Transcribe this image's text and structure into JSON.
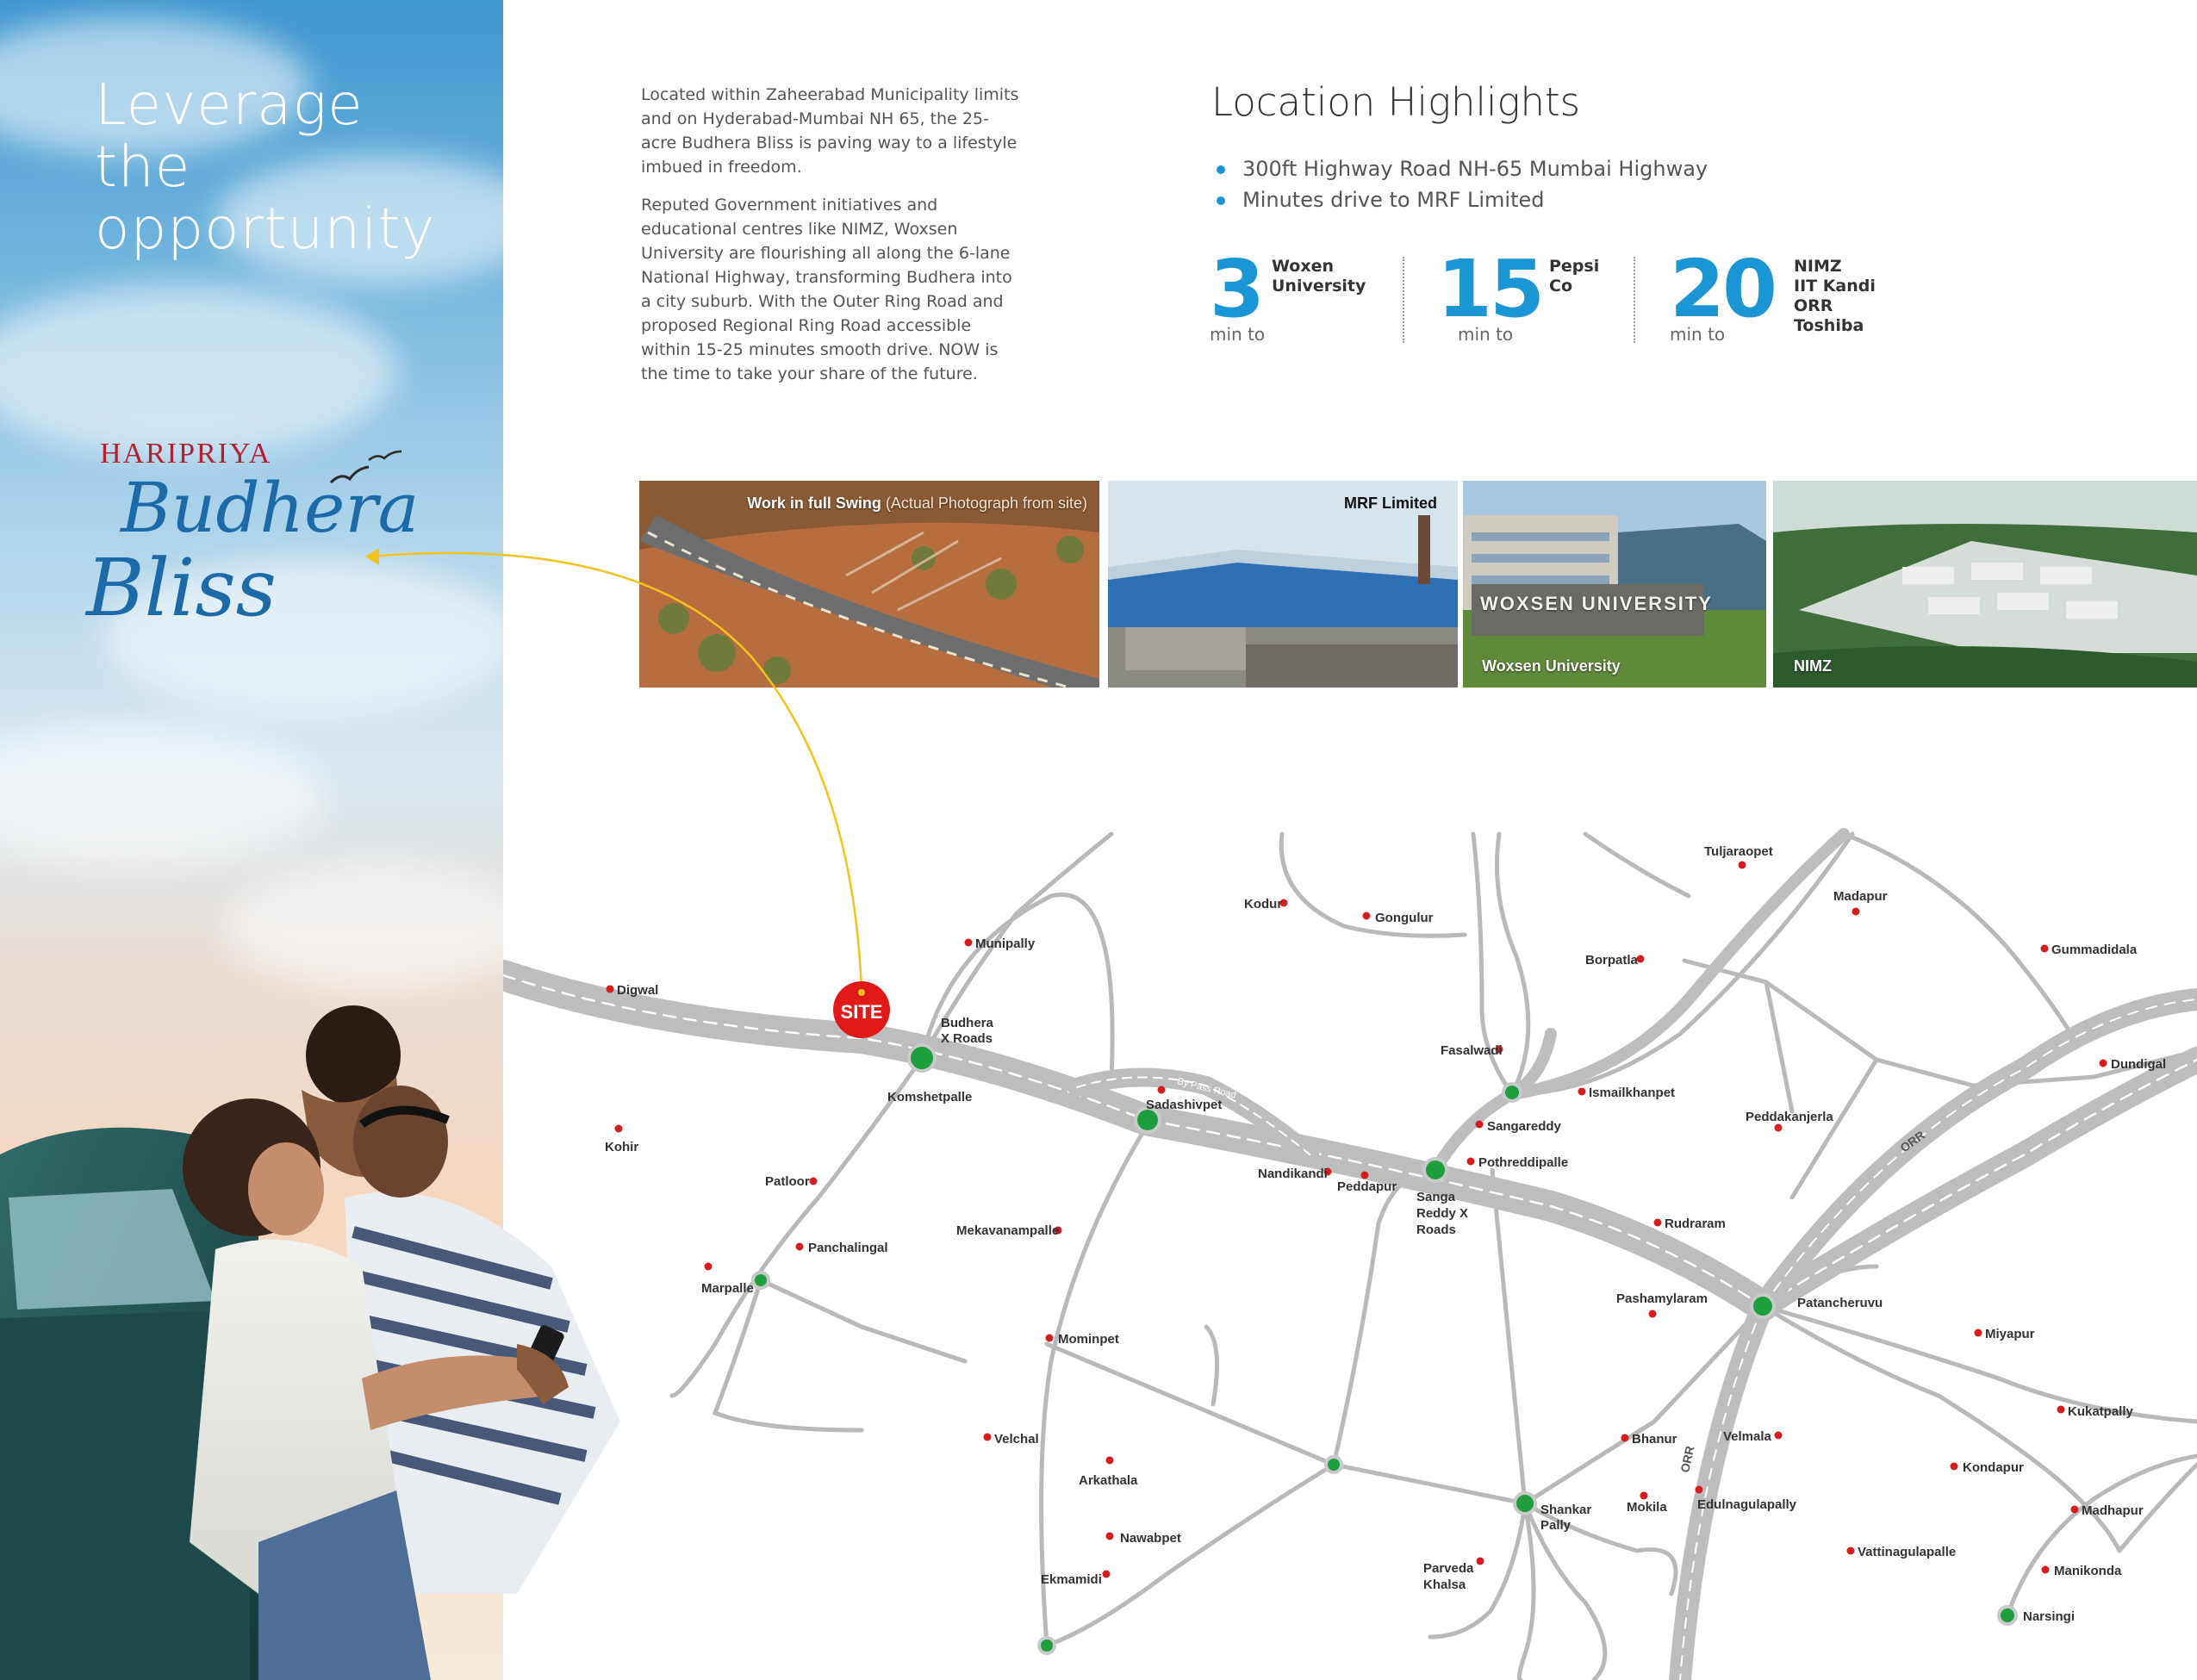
{
  "headline": {
    "line1": "Leverage",
    "line2": "the",
    "line3": "opportunity"
  },
  "brand": {
    "name": "HARIPRIYA",
    "project_line1": "Budhera",
    "project_line2": "Bliss"
  },
  "intro": {
    "p1": "Located within Zaheerabad Municipality limits and on Hyderabad-Mumbai NH 65, the 25-acre Budhera Bliss is paving way to a lifestyle imbued in freedom.",
    "p2": "Reputed Government initiatives and educational centres like NIMZ, Woxsen University are flourishing all along the 6-lane National Highway, transforming Budhera into a city suburb. With the Outer Ring Road and proposed Regional Ring Road accessible within 15-25 minutes smooth drive. NOW is the time to take your share of the future."
  },
  "highlights": {
    "title": "Location Highlights",
    "items": [
      "300ft Highway Road NH-65 Mumbai Highway",
      "Minutes drive to MRF Limited"
    ],
    "stats": [
      {
        "num": "3",
        "unit": "min to",
        "dest": [
          "Woxen",
          "University"
        ]
      },
      {
        "num": "15",
        "unit": "min to",
        "dest": [
          "Pepsi",
          "Co"
        ]
      },
      {
        "num": "20",
        "unit": "min to",
        "dest": [
          "NIMZ",
          "IIT Kandi",
          "ORR",
          "Toshiba"
        ]
      }
    ]
  },
  "photos": {
    "site_caption": "Work in full Swing",
    "site_sub": "(Actual Photograph from site)",
    "mrf_caption": "MRF Limited",
    "woxsen_caption": "Woxsen University",
    "woxsen_sign": "WOXSEN UNIVERSITY",
    "nimz_caption": "NIMZ"
  },
  "map": {
    "site_label": "SITE",
    "road_labels": {
      "bypass": "By Pass Road",
      "orr1": "ORR",
      "orr2": "ORR"
    },
    "places": {
      "digwal": "Digwal",
      "kohir": "Kohir",
      "munipally": "Munipally",
      "budhera1": "Budhera",
      "budhera2": "X Roads",
      "komshetpalle": "Komshetpalle",
      "sadashivpet": "Sadashivpet",
      "patloor": "Patloor",
      "panchalingal": "Panchalingal",
      "marpalle": "Marpalle",
      "mekavanampalle": "Mekavanampalle",
      "mominpet": "Mominpet",
      "velchal": "Velchal",
      "arkathala": "Arkathala",
      "nawabpet": "Nawabpet",
      "ekmamidi": "Ekmamidi",
      "kodur": "Kodur",
      "gongulur": "Gongulur",
      "fasalwadi": "Fasalwadi",
      "sangareddy": "Sangareddy",
      "ismailkhanpet": "Ismailkhanpet",
      "pothreddipalle": "Pothreddipalle",
      "nandikandi": "Nandikandi",
      "peddapur": "Peddapur",
      "sanga1": "Sanga",
      "sanga2": "Reddy X",
      "sanga3": "Roads",
      "borpatla": "Borpatla",
      "tuljaraopet": "Tuljaraopet",
      "madapur": "Madapur",
      "gummadidala": "Gummadidala",
      "dundigal": "Dundigal",
      "peddakanjerla": "Peddakanjerla",
      "rudraram": "Rudraram",
      "pashamylaram": "Pashamylaram",
      "patancheruvu": "Patancheruvu",
      "miyapur": "Miyapur",
      "kukatpally": "Kukatpally",
      "kondapur": "Kondapur",
      "madhapur": "Madhapur",
      "manikonda": "Manikonda",
      "narsingi": "Narsingi",
      "vattinagulapalle": "Vattinagulapalle",
      "velmala": "Velmala",
      "edulnagulapally": "Edulnagulapally",
      "bhanur": "Bhanur",
      "mokila": "Mokila",
      "shankar1": "Shankar",
      "shankar2": "Pally",
      "parveda1": "Parveda",
      "parveda2": "Khalsa"
    }
  },
  "colors": {
    "accent": "#1a96d4",
    "brand_red": "#b5202e",
    "script_blue": "#1d6aa8",
    "node_green": "#1f9e3e",
    "road_gray": "#b9b9b9",
    "site_red": "#e01919"
  }
}
